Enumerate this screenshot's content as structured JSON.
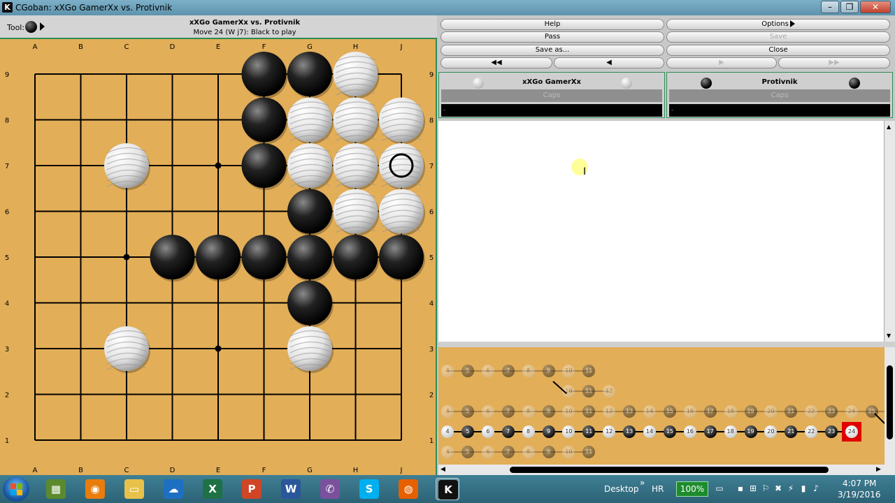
{
  "window": {
    "title": "CGoban: xXGo GamerXx vs. Protivnik",
    "app_icon": "K",
    "minimize": "–",
    "maximize": "❐",
    "close": "✕"
  },
  "board_header": {
    "tool_label": "Tool:",
    "game_title": "xXGo GamerXx vs. Protivnik",
    "status": "Move 24 (W j7): Black to play"
  },
  "board": {
    "columns": [
      "A",
      "B",
      "C",
      "D",
      "E",
      "F",
      "G",
      "H",
      "J"
    ],
    "rows": [
      "9",
      "8",
      "7",
      "6",
      "5",
      "4",
      "3",
      "2",
      "1"
    ],
    "hoshi": [
      "E7",
      "C5",
      "E3"
    ],
    "stones": [
      {
        "c": "F9",
        "s": "b"
      },
      {
        "c": "G9",
        "s": "b"
      },
      {
        "c": "H9",
        "s": "w"
      },
      {
        "c": "F8",
        "s": "b"
      },
      {
        "c": "G8",
        "s": "w"
      },
      {
        "c": "H8",
        "s": "w"
      },
      {
        "c": "J8",
        "s": "w"
      },
      {
        "c": "C7",
        "s": "w"
      },
      {
        "c": "F7",
        "s": "b"
      },
      {
        "c": "G7",
        "s": "w"
      },
      {
        "c": "H7",
        "s": "w"
      },
      {
        "c": "J7",
        "s": "w"
      },
      {
        "c": "G6",
        "s": "b"
      },
      {
        "c": "H6",
        "s": "w"
      },
      {
        "c": "J6",
        "s": "w"
      },
      {
        "c": "D5",
        "s": "b"
      },
      {
        "c": "E5",
        "s": "b"
      },
      {
        "c": "F5",
        "s": "b"
      },
      {
        "c": "G5",
        "s": "b"
      },
      {
        "c": "H5",
        "s": "b"
      },
      {
        "c": "J5",
        "s": "b"
      },
      {
        "c": "G4",
        "s": "b"
      },
      {
        "c": "C3",
        "s": "w"
      },
      {
        "c": "G3",
        "s": "w"
      }
    ],
    "last_move": "J7",
    "colors": {
      "board": "#e2ae58",
      "line": "#000000"
    }
  },
  "controls": {
    "help": "Help",
    "options": "Options",
    "pass": "Pass",
    "save": "Save",
    "save_as": "Save as...",
    "close": "Close"
  },
  "players": {
    "white": {
      "name": "xXGo GamerXx",
      "caps_label": "Caps",
      "count": "-"
    },
    "black": {
      "name": "Protivnik",
      "caps_label": "Caps",
      "count": "-"
    }
  },
  "tree": {
    "rows": [
      {
        "dim": true,
        "nodes": [
          {
            "n": "4",
            "s": "w"
          },
          {
            "n": "5",
            "s": "b"
          },
          {
            "n": "6",
            "s": "w"
          },
          {
            "n": "7",
            "s": "b"
          },
          {
            "n": "8",
            "s": "w"
          },
          {
            "n": "9",
            "s": "b"
          },
          {
            "n": "10",
            "s": "w"
          },
          {
            "n": "11",
            "s": "b"
          }
        ]
      },
      {
        "dim": true,
        "start": 6,
        "nodes": [
          {
            "n": "10",
            "s": "w"
          },
          {
            "n": "11",
            "s": "b"
          },
          {
            "n": "12",
            "s": "w"
          }
        ]
      },
      {
        "dim": true,
        "nodes": [
          {
            "n": "4",
            "s": "w"
          },
          {
            "n": "5",
            "s": "b"
          },
          {
            "n": "6",
            "s": "w"
          },
          {
            "n": "7",
            "s": "b"
          },
          {
            "n": "8",
            "s": "w"
          },
          {
            "n": "9",
            "s": "b"
          },
          {
            "n": "10",
            "s": "w"
          },
          {
            "n": "11",
            "s": "b"
          },
          {
            "n": "12",
            "s": "w"
          },
          {
            "n": "13",
            "s": "b"
          },
          {
            "n": "14",
            "s": "w"
          },
          {
            "n": "15",
            "s": "b"
          },
          {
            "n": "16",
            "s": "w"
          },
          {
            "n": "17",
            "s": "b"
          },
          {
            "n": "18",
            "s": "w"
          },
          {
            "n": "19",
            "s": "b"
          },
          {
            "n": "20",
            "s": "w"
          },
          {
            "n": "21",
            "s": "b"
          },
          {
            "n": "22",
            "s": "w"
          },
          {
            "n": "23",
            "s": "b"
          },
          {
            "n": "24",
            "s": "w"
          },
          {
            "n": "25",
            "s": "b"
          }
        ]
      },
      {
        "dim": false,
        "nodes": [
          {
            "n": "4",
            "s": "w"
          },
          {
            "n": "5",
            "s": "b"
          },
          {
            "n": "6",
            "s": "w"
          },
          {
            "n": "7",
            "s": "b"
          },
          {
            "n": "8",
            "s": "w"
          },
          {
            "n": "9",
            "s": "b"
          },
          {
            "n": "10",
            "s": "w"
          },
          {
            "n": "11",
            "s": "b"
          },
          {
            "n": "12",
            "s": "w"
          },
          {
            "n": "13",
            "s": "b"
          },
          {
            "n": "14",
            "s": "w"
          },
          {
            "n": "15",
            "s": "b"
          },
          {
            "n": "16",
            "s": "w"
          },
          {
            "n": "17",
            "s": "b"
          },
          {
            "n": "18",
            "s": "w"
          },
          {
            "n": "19",
            "s": "b"
          },
          {
            "n": "20",
            "s": "w"
          },
          {
            "n": "21",
            "s": "b"
          },
          {
            "n": "22",
            "s": "w"
          },
          {
            "n": "23",
            "s": "b"
          },
          {
            "n": "24",
            "s": "w",
            "current": true
          }
        ]
      },
      {
        "dim": true,
        "nodes": [
          {
            "n": "4",
            "s": "w"
          },
          {
            "n": "5",
            "s": "b"
          },
          {
            "n": "6",
            "s": "w"
          },
          {
            "n": "7",
            "s": "b"
          },
          {
            "n": "8",
            "s": "w"
          },
          {
            "n": "9",
            "s": "b"
          },
          {
            "n": "10",
            "s": "w"
          },
          {
            "n": "11",
            "s": "b"
          }
        ]
      }
    ]
  },
  "taskbar": {
    "apps": [
      {
        "name": "minecraft-icon",
        "glyph": "▦",
        "bg": "#5b8a2e"
      },
      {
        "name": "blender-icon",
        "glyph": "◉",
        "bg": "#e87d0d"
      },
      {
        "name": "file-explorer-icon",
        "glyph": "▭",
        "bg": "#e8c14a"
      },
      {
        "name": "onedrive-icon",
        "glyph": "☁",
        "bg": "#1d6fc2"
      },
      {
        "name": "excel-icon",
        "glyph": "X",
        "bg": "#1e7145"
      },
      {
        "name": "powerpoint-icon",
        "glyph": "P",
        "bg": "#d04525"
      },
      {
        "name": "word-icon",
        "glyph": "W",
        "bg": "#2b579a"
      },
      {
        "name": "viber-icon",
        "glyph": "✆",
        "bg": "#7b519d"
      },
      {
        "name": "skype-icon",
        "glyph": "S",
        "bg": "#00aff0"
      },
      {
        "name": "firefox-icon",
        "glyph": "◍",
        "bg": "#e66000"
      },
      {
        "name": "cgoban-icon",
        "glyph": "K",
        "bg": "#111111",
        "active": true
      }
    ],
    "desktop_label": "Desktop",
    "chevron": "»",
    "lang": "HR",
    "battery": "100%",
    "time": "4:07 PM",
    "date": "3/19/2016"
  }
}
